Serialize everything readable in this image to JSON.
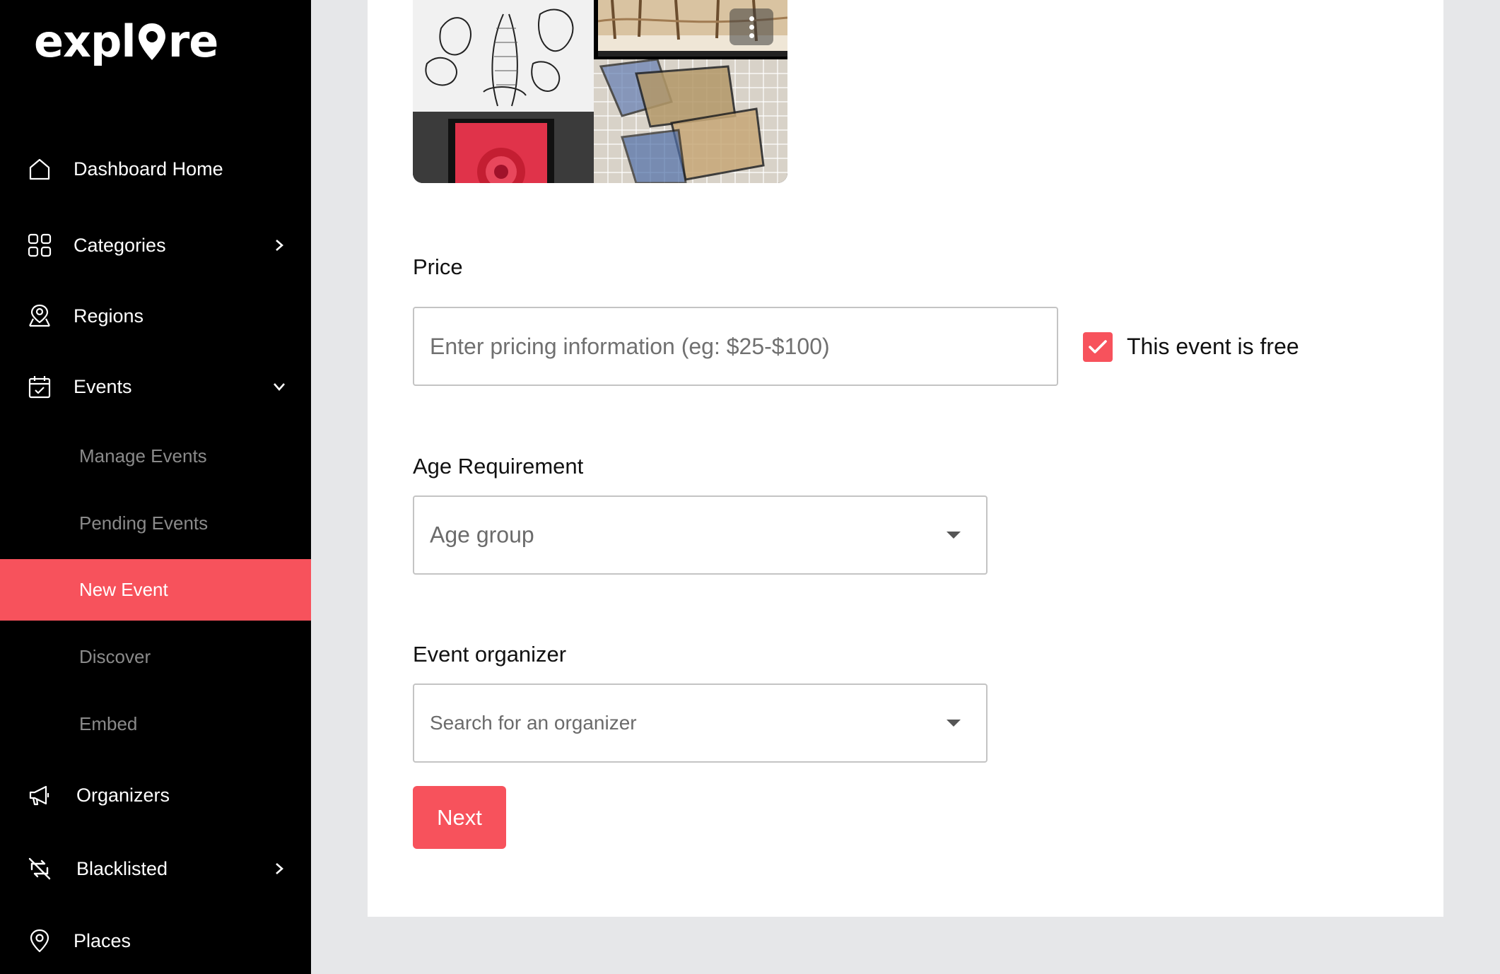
{
  "app": {
    "logo_text_prefix": "expl",
    "logo_text_suffix": "re"
  },
  "sidebar": {
    "items": [
      {
        "label": "Dashboard Home",
        "icon": "home-icon"
      },
      {
        "label": "Categories",
        "icon": "grid-icon",
        "chevron": "right"
      },
      {
        "label": "Regions",
        "icon": "map-user-icon"
      },
      {
        "label": "Events",
        "icon": "calendar-check-icon",
        "chevron": "down"
      }
    ],
    "sub_items": [
      {
        "label": "Manage Events"
      },
      {
        "label": "Pending Events"
      },
      {
        "label": "New Event",
        "active": true
      },
      {
        "label": "Discover"
      },
      {
        "label": "Embed"
      }
    ],
    "bottom_items": [
      {
        "label": "Organizers",
        "icon": "megaphone-icon"
      },
      {
        "label": "Blacklisted",
        "icon": "blocked-sync-icon",
        "chevron": "right"
      },
      {
        "label": "Places",
        "icon": "location-pin-icon"
      }
    ]
  },
  "form": {
    "price": {
      "label": "Price",
      "placeholder": "Enter pricing information (eg: $25-$100)",
      "value": ""
    },
    "free_checkbox": {
      "label": "This event is free",
      "checked": true
    },
    "age": {
      "label": "Age Requirement",
      "placeholder": "Age group"
    },
    "organizer": {
      "label": "Event organizer",
      "placeholder": "Search for an organizer"
    },
    "next_label": "Next"
  },
  "colors": {
    "accent": "#f7525c",
    "sidebar_bg": "#000000",
    "page_bg": "#e6e7e9"
  }
}
